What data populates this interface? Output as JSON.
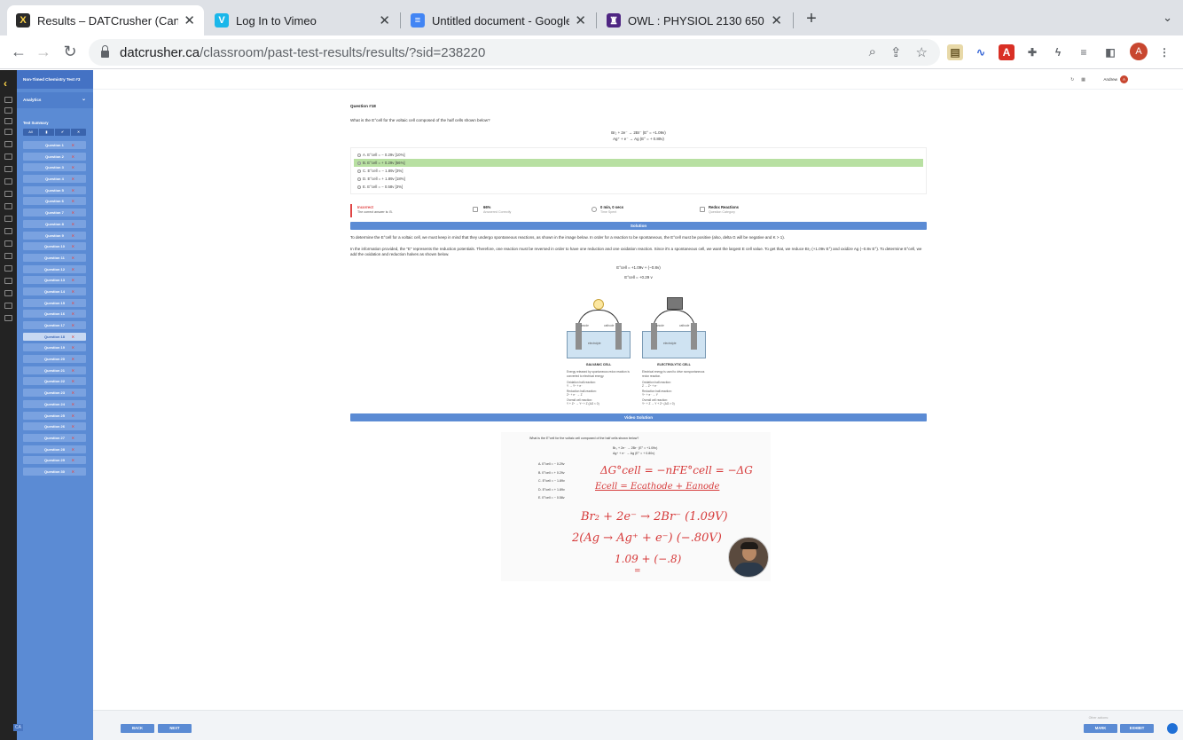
{
  "browser": {
    "tabs": [
      {
        "title": "Results – DATCrusher (Canadia",
        "favicon": "X",
        "active": true
      },
      {
        "title": "Log In to Vimeo",
        "favicon": "V",
        "active": false
      },
      {
        "title": "Untitled document - Google Do",
        "favicon": "≡",
        "active": false
      },
      {
        "title": "OWL : PHYSIOL 2130 650 SU2",
        "favicon": "♜",
        "active": false
      }
    ],
    "url_host": "datcrusher.ca",
    "url_path": "/classroom/past-test-results/results/?sid=238220",
    "profile_initial": "A"
  },
  "sidebar": {
    "test_title": "Non-Timed Chemistry Test #3",
    "analytics_label": "Analytics",
    "summary_label": "Test Summary",
    "filters": [
      "All",
      "▮",
      "✔",
      "✕"
    ],
    "questions": [
      "Question 1",
      "Question 2",
      "Question 3",
      "Question 4",
      "Question 5",
      "Question 6",
      "Question 7",
      "Question 8",
      "Question 9",
      "Question 10",
      "Question 11",
      "Question 12",
      "Question 13",
      "Question 14",
      "Question 15",
      "Question 16",
      "Question 17",
      "Question 18",
      "Question 19",
      "Question 20",
      "Question 21",
      "Question 22",
      "Question 23",
      "Question 24",
      "Question 25",
      "Question 26",
      "Question 27",
      "Question 28",
      "Question 29",
      "Question 30"
    ],
    "selected_index": 17,
    "bottom_badge": "CA"
  },
  "topbar": {
    "user": "Andrew",
    "user_initial": "A"
  },
  "question": {
    "number": "Question #18",
    "text": "What is the E°cell for the voltaic cell composed of the half cells shown below?",
    "eq1": "Br₂ + 2e⁻ → 2Br⁻ (E° = +1.09v)",
    "eq2": "Ag⁺ + e⁻ → Ag (E° = + 0.80v)",
    "choices": [
      "A. E°cell = − 0.29v [10%]",
      "B. E°cell = + 0.29v [66%]",
      "C. E°cell = − 1.89v [3%]",
      "D. E°cell = + 1.89v [18%]",
      "E. E°cell = − 0.58v [3%]"
    ],
    "correct_index": 1
  },
  "result": {
    "status": "Incorrect",
    "status_sub": "The correct answer is: B.",
    "pct": "66%",
    "pct_sub": "Answered Correctly",
    "time": "0 min, 0 secs",
    "time_sub": "Time Spent",
    "category": "Redox Reactions",
    "category_sub": "Question Category"
  },
  "solution": {
    "header": "Solution",
    "p1": "To determine the E°cell for a voltaic cell, we must keep in mind that they undergo spontaneous reactions, as shown in the image below. In order for a reaction to be spontaneous, the E°cell must be positive (also, delta G will be negative and K > 1).",
    "p2": "In the information provided, the \"E\" represents the reduction potentials. Therefore, one reaction must be reversed in order to have one reduction and one oxidation reaction. Since it's a spontaneous cell, we want the largest E cell value. To get that, we reduce Br₂ (+1.09v E°) and oxidize Ag (−0.8v E°). To determine E°cell, we add the oxidation and reduction halves as shown below.",
    "calc1": "E°cell = +1.09v + (−0.8v)",
    "calc2": "E°cell = +0.29 v"
  },
  "diagram": {
    "galvanic": {
      "title": "GALVANIC CELL",
      "anode": "anode",
      "cathode": "cathode",
      "electrolyte": "electrolyte",
      "desc": "Energy released by spontaneous redox reaction is converted to electrical energy.",
      "ox_label": "Oxidation half-reaction:",
      "ox": "Y → Y⁺ + e⁻",
      "red_label": "Reduction half-reaction:",
      "red": "Z⁺ + e⁻ → Z",
      "overall_label": "Overall cell reaction:",
      "overall": "Y + Z⁺ → Y⁺ + Z  (ΔG < 0)"
    },
    "electrolytic": {
      "title": "ELECTROLYTIC CELL",
      "anode": "anode",
      "cathode": "cathode",
      "electrolyte": "electrolyte",
      "desc": "Electrical energy is used to drive nonspontaneous redox reaction.",
      "ox_label": "Oxidation half-reaction:",
      "ox": "Z → Z⁺ + e⁻",
      "red_label": "Reduction half-reaction:",
      "red": "Y⁺ + e⁻ → Y",
      "overall_label": "Overall cell reaction:",
      "overall": "Y⁺ + Z → Y + Z⁺  (ΔG > 0)"
    }
  },
  "video": {
    "header": "Video Solution",
    "q": "What is the E°cell for the voltaic cell composed of the half cells shown below?",
    "eq1": "Br₂ + 2e⁻ → 2Br⁻ (E° = +1.09v)",
    "eq2": "Ag⁺ + e⁻ → Ag (E° = + 0.80v)",
    "choices": [
      "A. E°cell = − 0.29v",
      "B. E°cell = + 0.29v",
      "C. E°cell = − 1.89v",
      "D. E°cell = + 1.89v",
      "E. E°cell = − 0.58v"
    ],
    "ink1": "ΔG°cell = −nFE°cell = −ΔG",
    "ink2": "Ecell = Ecathode + Eanode",
    "ink3": "Br₂ + 2e⁻ → 2Br⁻  (1.09V)",
    "ink4": "2(Ag → Ag⁺ + e⁻)  (−.80V)",
    "ink5": "1.09 + (−.8)",
    "ink6": "="
  },
  "footer": {
    "back": "BACK",
    "next": "NEXT",
    "other": "Other actions:",
    "mark": "MARK",
    "exhibit": "EXHIBIT"
  },
  "colors": {
    "sidebar": "#5b8bd4",
    "correct": "#b8e0a2",
    "incorrect": "#e04545",
    "ink": "#d63a3a"
  }
}
